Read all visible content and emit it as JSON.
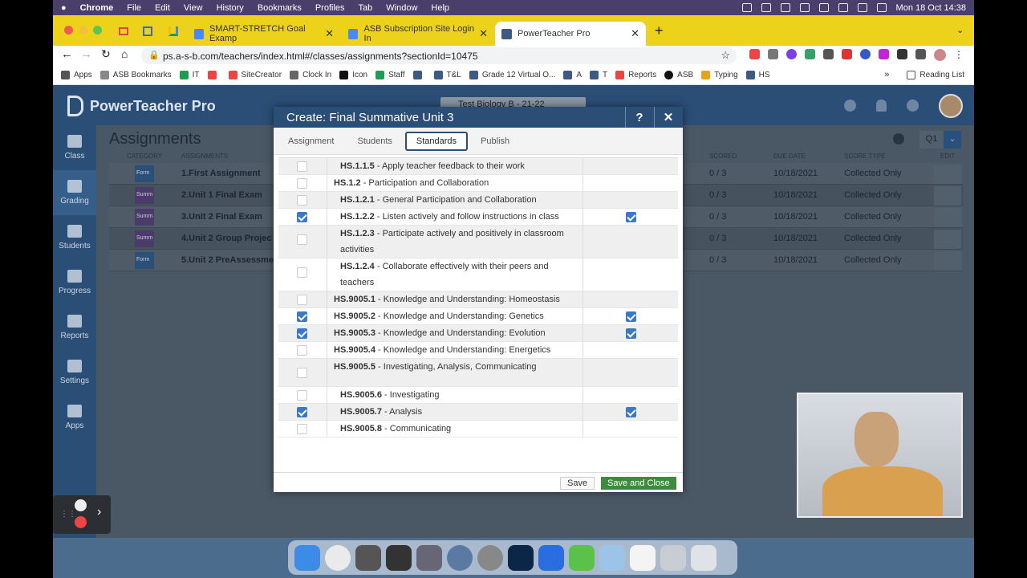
{
  "menubar": {
    "app": "Chrome",
    "items": [
      "File",
      "Edit",
      "View",
      "History",
      "Bookmarks",
      "Profiles",
      "Tab",
      "Window",
      "Help"
    ],
    "clock": "Mon 18 Oct  14:38"
  },
  "browser": {
    "tabs": [
      {
        "label": "SMART-STRETCH Goal Examp",
        "color": "#4a8af4"
      },
      {
        "label": "ASB Subscription Site Login In",
        "color": "#4a8af4"
      },
      {
        "label": "PowerTeacher Pro",
        "color": "#3c5a82"
      }
    ],
    "url": "ps.a-s-b.com/teachers/index.html#/classes/assignments?sectionId=10475",
    "bookmarks": [
      "Apps",
      "ASB Bookmarks",
      "IT",
      "SiteCreator",
      "Clock In",
      "Icon",
      "Staff",
      "T&L",
      "Grade 12 Virtual O...",
      "A",
      "T",
      "Reports",
      "ASB",
      "Typing",
      "HS"
    ],
    "reading_list": "Reading List"
  },
  "app": {
    "name": "PowerTeacher Pro",
    "class_selector": "Test Biology B - 21-22",
    "nav": [
      "Class",
      "Grading",
      "Students",
      "Progress",
      "Reports",
      "Settings",
      "Apps"
    ],
    "page_title": "Assignments",
    "term": "Q1",
    "grid_headers": {
      "category": "CATEGORY",
      "assignments": "ASSIGNMENTS",
      "scored": "SCORED",
      "due": "DUE DATE",
      "score_type": "SCORE TYPE",
      "edit": "EDIT"
    },
    "rows": [
      {
        "cat": "Form",
        "name": "1.First Assignment",
        "scored": "0 / 3",
        "due": "10/18/2021",
        "type": "Collected Only"
      },
      {
        "cat": "Summ",
        "name": "2.Unit 1 Final Exam",
        "scored": "0 / 3",
        "due": "10/18/2021",
        "type": "Collected Only"
      },
      {
        "cat": "Summ",
        "name": "3.Unit 2 Final Exam",
        "scored": "0 / 3",
        "due": "10/18/2021",
        "type": "Collected Only"
      },
      {
        "cat": "Summ",
        "name": "4.Unit 2 Group Projec",
        "scored": "0 / 3",
        "due": "10/18/2021",
        "type": "Collected Only"
      },
      {
        "cat": "Form",
        "name": "5.Unit 2 PreAssessme",
        "scored": "0 / 3",
        "due": "10/18/2021",
        "type": "Collected Only"
      }
    ]
  },
  "modal": {
    "title": "Create: Final Summative Unit 3",
    "help": "?",
    "close": "✕",
    "tabs": [
      "Assignment",
      "Students",
      "Standards",
      "Publish"
    ],
    "selected_tab": "Standards",
    "standards": [
      {
        "code": "HS.1.1.5",
        "desc": " - Apply teacher feedback to their work",
        "checked": false,
        "calc": false,
        "indent": 1
      },
      {
        "code": "HS.1.2",
        "desc": " - Participation and Collaboration",
        "checked": false,
        "calc": false,
        "indent": 0
      },
      {
        "code": "HS.1.2.1",
        "desc": " - General Participation and Collaboration",
        "checked": false,
        "calc": false,
        "indent": 1
      },
      {
        "code": "HS.1.2.2",
        "desc": " - Listen actively and follow instructions in class",
        "checked": true,
        "calc": true,
        "indent": 1
      },
      {
        "code": "HS.1.2.3",
        "desc": " - Participate actively and positively in classroom activities",
        "checked": false,
        "calc": false,
        "indent": 1
      },
      {
        "code": "HS.1.2.4",
        "desc": " - Collaborate effectively with their peers and teachers",
        "checked": false,
        "calc": false,
        "indent": 1
      },
      {
        "code": "HS.9005.1",
        "desc": " - Knowledge and Understanding: Homeostasis",
        "checked": false,
        "calc": false,
        "indent": 0
      },
      {
        "code": "HS.9005.2",
        "desc": " - Knowledge and Understanding: Genetics",
        "checked": true,
        "calc": true,
        "indent": 0
      },
      {
        "code": "HS.9005.3",
        "desc": " - Knowledge and Understanding: Evolution",
        "checked": true,
        "calc": true,
        "indent": 0
      },
      {
        "code": "HS.9005.4",
        "desc": " - Knowledge and Understanding: Energetics",
        "checked": false,
        "calc": false,
        "indent": 0
      },
      {
        "code": "HS.9005.5",
        "desc": " - Investigating, Analysis, Communicating",
        "checked": false,
        "calc": false,
        "indent": 0
      },
      {
        "code": "HS.9005.6",
        "desc": " - Investigating",
        "checked": false,
        "calc": false,
        "indent": 1
      },
      {
        "code": "HS.9005.7",
        "desc": " - Analysis",
        "checked": true,
        "calc": true,
        "indent": 1
      },
      {
        "code": "HS.9005.8",
        "desc": " - Communicating",
        "checked": false,
        "calc": false,
        "indent": 1
      }
    ],
    "save": "Save",
    "save_close": "Save and Close"
  }
}
